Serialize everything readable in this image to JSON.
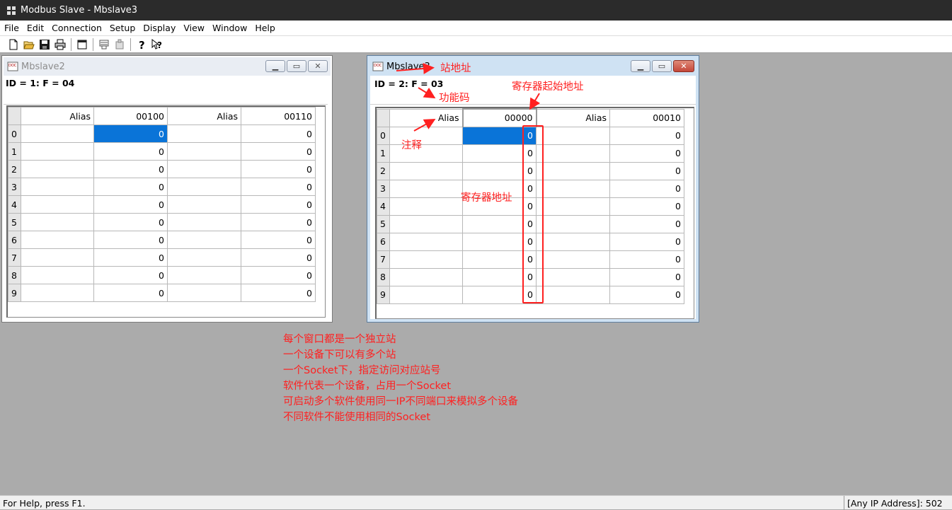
{
  "window": {
    "title": "Modbus Slave - Mbslave3"
  },
  "menu": [
    "File",
    "Edit",
    "Connection",
    "Setup",
    "Display",
    "View",
    "Window",
    "Help"
  ],
  "toolbar": [
    "new-icon",
    "open-icon",
    "save-icon",
    "print-icon",
    "window-icon",
    "connect-icon",
    "disconnect-icon",
    "help-icon",
    "context-help-icon"
  ],
  "mbslave2": {
    "title": "Mbslave2",
    "info": "ID = 1: F = 04",
    "headers": {
      "alias1": "Alias",
      "addr1": "00100",
      "alias2": "Alias",
      "addr2": "00110"
    },
    "rows": [
      "0",
      "1",
      "2",
      "3",
      "4",
      "5",
      "6",
      "7",
      "8",
      "9"
    ],
    "values1": [
      "0",
      "0",
      "0",
      "0",
      "0",
      "0",
      "0",
      "0",
      "0",
      "0"
    ],
    "values2": [
      "0",
      "0",
      "0",
      "0",
      "0",
      "0",
      "0",
      "0",
      "0",
      "0"
    ]
  },
  "mbslave3": {
    "title": "Mbslave3",
    "info": "ID = 2: F = 03",
    "headers": {
      "alias1": "Alias",
      "addr1": "00000",
      "alias2": "Alias",
      "addr2": "00010"
    },
    "rows": [
      "0",
      "1",
      "2",
      "3",
      "4",
      "5",
      "6",
      "7",
      "8",
      "9"
    ],
    "values1": [
      "0",
      "0",
      "0",
      "0",
      "0",
      "0",
      "0",
      "0",
      "0",
      "0"
    ],
    "values2": [
      "0",
      "0",
      "0",
      "0",
      "0",
      "0",
      "0",
      "0",
      "0",
      "0"
    ]
  },
  "annotations": {
    "station_address": "站地址",
    "function_code": "功能码",
    "register_start_address": "寄存器起始地址",
    "comment": "注释",
    "register_address": "寄存器地址",
    "notes": [
      "每个窗口都是一个独立站",
      "一个设备下可以有多个站",
      "一个Socket下，指定访问对应站号",
      "软件代表一个设备，占用一个Socket",
      "可启动多个软件使用同一IP不同端口来模拟多个设备",
      "不同软件不能使用相同的Socket"
    ]
  },
  "status": {
    "help": "For Help, press F1.",
    "connection": "[Any IP Address]: 502"
  },
  "colors": {
    "annotation": "#ff2020",
    "selection": "#0a74d8",
    "mdi_background": "#ababab"
  }
}
